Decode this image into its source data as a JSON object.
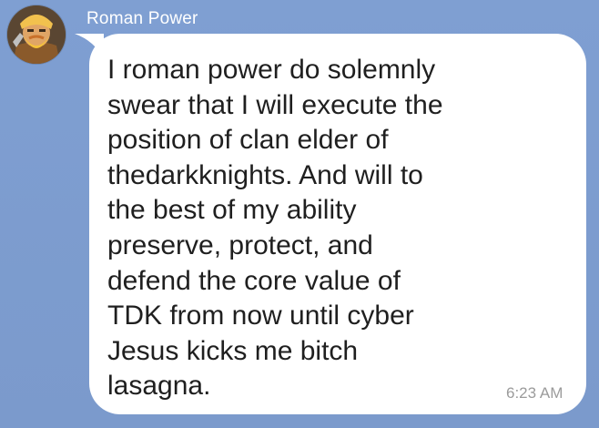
{
  "chat": {
    "background_color": "#7d9ccf",
    "bubble_color": "#ffffff"
  },
  "message": {
    "sender": "Roman Power",
    "avatar_icon": "barbarian-avatar-icon",
    "text": "I roman power do solemnly\nswear that I will execute the\nposition of clan elder of\nthedarkknights. And will to\nthe best of my ability\npreserve, protect, and\ndefend the core value of\nTDK from now until cyber\nJesus kicks me bitch\nlasagna.",
    "time": "6:23 AM"
  }
}
